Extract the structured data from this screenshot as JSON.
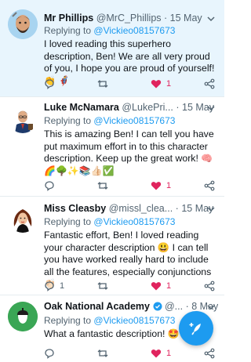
{
  "tweets": [
    {
      "name": "Mr Phillips",
      "handle": "@MrC_Phillips",
      "dot": "·",
      "time": "15 May",
      "reply_prefix": "Replying to",
      "reply_to": "@Vickieo08157673",
      "text": "I loved reading this superhero description, Ben! We are all very proud of you, I hope you are proud of yourself!",
      "emoji": "👏 🦸‍♂️",
      "reply_count": "",
      "retweet_count": "",
      "like_count": "1",
      "liked": true
    },
    {
      "name": "Luke McNamara",
      "handle": "@LukePri...",
      "dot": "·",
      "time": "15 May",
      "reply_prefix": "Replying to",
      "reply_to": "@Vickieo08157673",
      "text": "This is amazing Ben! I can tell you have put maximum effort in to this character description. Keep up the great work!",
      "emoji": "🧠🌈🌳✨📚👍🏻✅",
      "reply_count": "",
      "retweet_count": "",
      "like_count": "1",
      "liked": true
    },
    {
      "name": "Miss Cleasby",
      "handle": "@missl_clea...",
      "dot": "·",
      "time": "15 May",
      "reply_prefix": "Replying to",
      "reply_to": "@Vickieo08157673",
      "text": "Fantastic effort, Ben! I loved reading your character description 😃 I can tell you have worked really hard to include all the features, especially conjunctions",
      "emoji": "👏🏻",
      "reply_count": "1",
      "retweet_count": "",
      "like_count": "1",
      "liked": true
    },
    {
      "name": "Oak National Academy",
      "handle": "@...",
      "dot": "·",
      "time": "8 May",
      "reply_prefix": "Replying to",
      "reply_to": "@Vickieo08157673",
      "text": "What a fantastic description!",
      "emoji": "🤩",
      "reply_count": "",
      "retweet_count": "",
      "like_count": "1",
      "liked": true
    }
  ],
  "colors": {
    "accent": "#1d9bf0",
    "like": "#e0245e",
    "highlight_bg": "#e8f5fd"
  }
}
